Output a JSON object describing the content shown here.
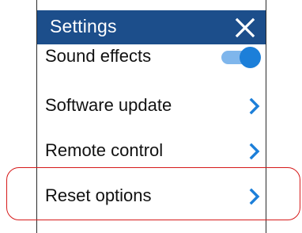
{
  "header": {
    "title": "Settings",
    "close_icon": "close-icon",
    "background_color": "#1c4e8b"
  },
  "settings": {
    "items": [
      {
        "label": "Sound effects",
        "control": "toggle",
        "toggle_state": "on"
      },
      {
        "label": "Software update",
        "control": "chevron-right-icon"
      },
      {
        "label": "Remote control",
        "control": "chevron-right-icon"
      },
      {
        "label": "Reset options",
        "control": "chevron-right-icon"
      }
    ]
  },
  "colors": {
    "accent": "#1c7fd9",
    "highlight": "#d61a1a"
  }
}
